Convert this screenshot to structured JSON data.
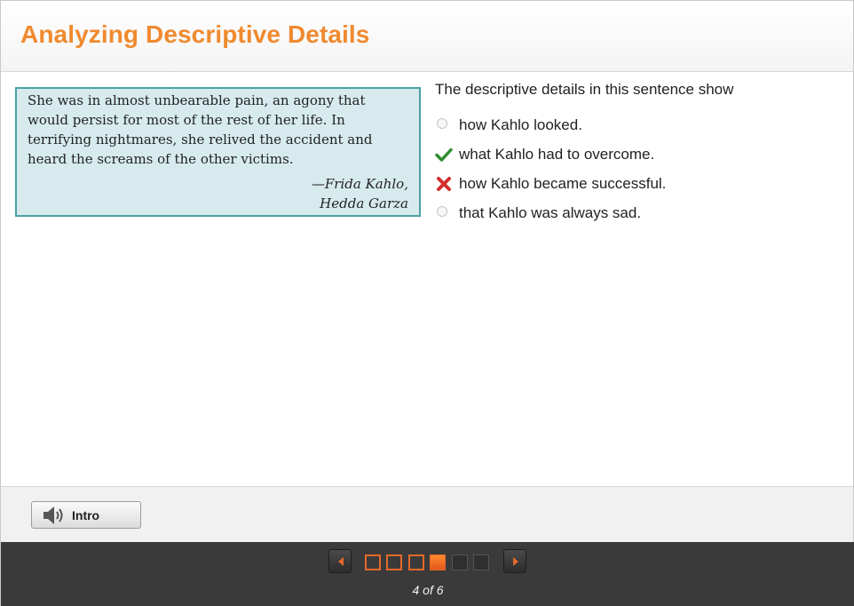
{
  "header": {
    "title": "Analyzing Descriptive Details"
  },
  "passage": {
    "text": "She was in almost unbearable pain, an agony that would persist for most of the rest of her life. In terrifying nightmares, she relived the accident and heard the screams of the other victims.",
    "attribution_line1": "—Frida Kahlo,",
    "attribution_line2": "Hedda Garza"
  },
  "question": {
    "prompt": "The descriptive details in this sentence show",
    "options": [
      {
        "label": "how Kahlo looked.",
        "state": "unselected"
      },
      {
        "label": "what Kahlo had to overcome.",
        "state": "correct"
      },
      {
        "label": "how Kahlo became successful.",
        "state": "incorrect"
      },
      {
        "label": "that Kahlo was always sad.",
        "state": "unselected"
      }
    ]
  },
  "footer": {
    "intro_label": "Intro",
    "intro_icon": "speaker-icon"
  },
  "navigation": {
    "prev_icon": "arrow-left-icon",
    "next_icon": "arrow-right-icon",
    "current_page": 4,
    "total_pages": 6,
    "page_states": [
      "done",
      "done",
      "done",
      "current",
      "todo",
      "todo"
    ],
    "page_label": "4 of 6"
  },
  "colors": {
    "title": "#f08a2f",
    "passage_bg": "#d7ebee",
    "passage_border": "#4aa1a6",
    "correct": "#2e8b2e",
    "incorrect": "#d32f2f",
    "nav_bg": "#3a3a3a",
    "page_accent": "#e4692a"
  }
}
